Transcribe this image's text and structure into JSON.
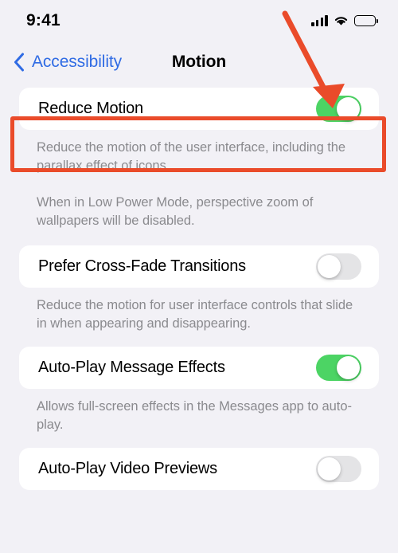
{
  "status_bar": {
    "time": "9:41",
    "cellular_icon": "cellular-signal-icon",
    "wifi_icon": "wifi-icon",
    "battery_icon": "battery-full-icon"
  },
  "nav_bar": {
    "back_icon": "chevron-left-icon",
    "back_label": "Accessibility",
    "title": "Motion"
  },
  "colors": {
    "background": "#F2F1F6",
    "card": "#FFFFFF",
    "accent_blue": "#2F6BE4",
    "toggle_on_green": "#4CD464",
    "toggle_off_gray": "#E4E4E6",
    "footer_gray": "#8A8A8E",
    "annotation_red": "#EA4B2A"
  },
  "sections": [
    {
      "row_label": "Reduce Motion",
      "toggle_state": "on",
      "footer": [
        "Reduce the motion of the user interface, including the parallax effect of icons.",
        "When in Low Power Mode, perspective zoom of wallpapers will be disabled."
      ]
    },
    {
      "row_label": "Prefer Cross-Fade Transitions",
      "toggle_state": "off",
      "footer": [
        "Reduce the motion for user interface controls that slide in when appearing and disappearing."
      ]
    },
    {
      "row_label": "Auto-Play Message Effects",
      "toggle_state": "on",
      "footer": [
        "Allows full-screen effects in the Messages app to auto-play."
      ]
    },
    {
      "row_label": "Auto-Play Video Previews",
      "toggle_state": "off",
      "footer": []
    }
  ],
  "annotation": {
    "arrow_icon": "red-arrow-pointer",
    "highlight_target": "Reduce Motion"
  }
}
